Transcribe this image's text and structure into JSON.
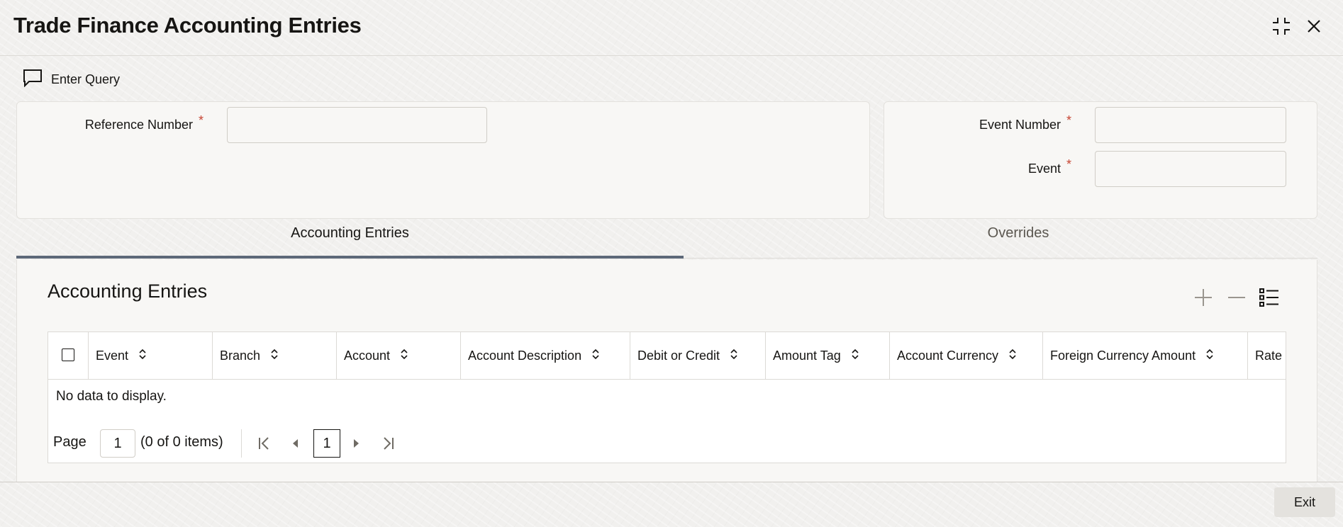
{
  "window": {
    "title": "Trade Finance Accounting Entries"
  },
  "toolbar": {
    "enter_query_label": "Enter Query"
  },
  "header_form": {
    "reference_number": {
      "label": "Reference Number",
      "required_mark": "*",
      "value": ""
    },
    "event_number": {
      "label": "Event Number",
      "required_mark": "*",
      "value": ""
    },
    "event": {
      "label": "Event",
      "required_mark": "*",
      "value": ""
    }
  },
  "tabs": [
    {
      "label": "Accounting Entries",
      "active": true
    },
    {
      "label": "Overrides",
      "active": false
    }
  ],
  "section": {
    "title": "Accounting Entries"
  },
  "table": {
    "columns": [
      "Event",
      "Branch",
      "Account",
      "Account Description",
      "Debit or Credit",
      "Amount Tag",
      "Account Currency",
      "Foreign Currency Amount",
      "Rate"
    ],
    "empty_text": "No data to display."
  },
  "pagination": {
    "page_label": "Page",
    "page_value": "1",
    "items_text": "(0 of 0 items)",
    "current_page": "1"
  },
  "footer": {
    "exit_label": "Exit"
  },
  "colors": {
    "accent_tab": "#5d6878",
    "required": "#c74634"
  }
}
